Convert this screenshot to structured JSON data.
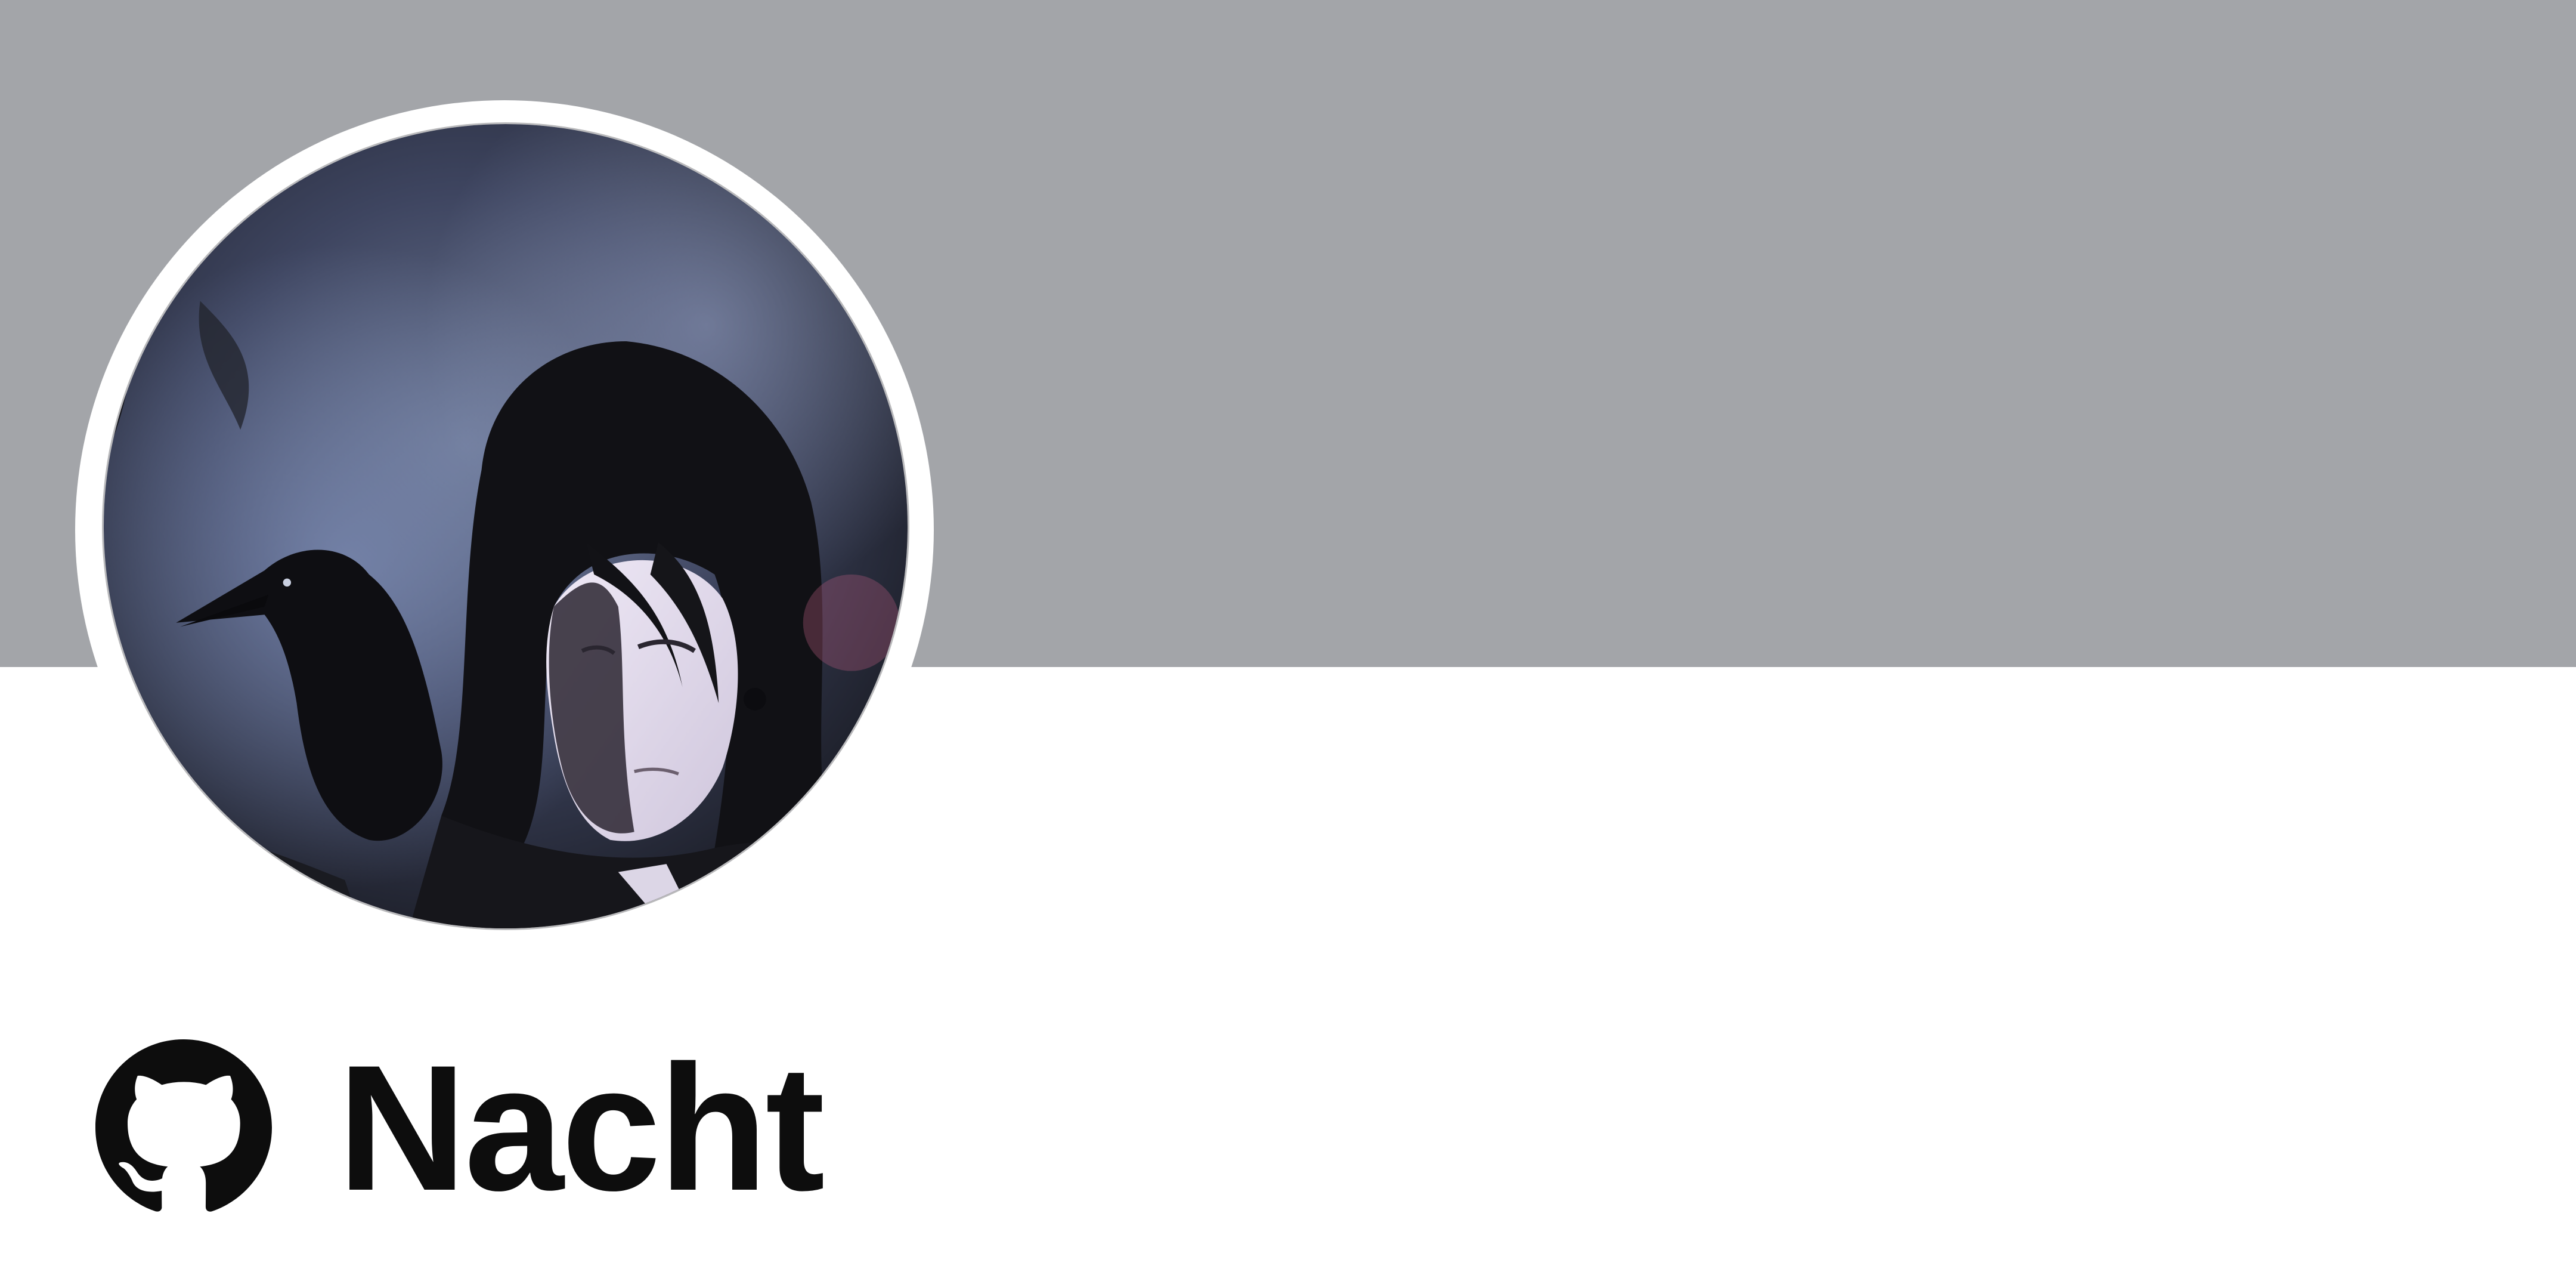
{
  "profile": {
    "name": "Nacht",
    "avatar_description": "portrait-illustration",
    "platform_icon": "github-icon"
  },
  "colors": {
    "banner": "#a3a5a9",
    "background": "#ffffff",
    "text": "#0d0d0d"
  }
}
